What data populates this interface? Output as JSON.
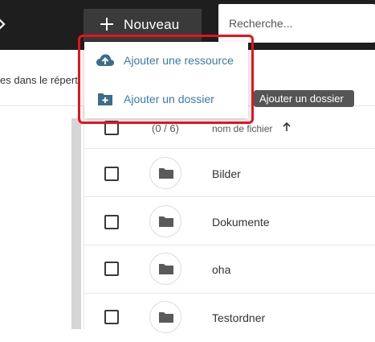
{
  "header": {
    "new_button_label": "Nouveau",
    "search_placeholder": "Recherche..."
  },
  "breadcrumb_text": "es dans le répert",
  "dropdown": {
    "items": [
      {
        "label": "Ajouter une ressource",
        "icon": "cloud-upload-icon"
      },
      {
        "label": "Ajouter un dossier",
        "icon": "folder-plus-icon"
      }
    ]
  },
  "tooltip": "Ajouter un dossier",
  "table": {
    "selection_count": "(0 / 6)",
    "column_name": "nom de fichier",
    "sort_icon": "arrow-up-icon",
    "rows": [
      {
        "name": "Bilder",
        "icon": "folder-icon"
      },
      {
        "name": "Dokumente",
        "icon": "folder-icon"
      },
      {
        "name": "oha",
        "icon": "folder-icon"
      },
      {
        "name": "Testordner",
        "icon": "folder-icon"
      }
    ]
  },
  "colors": {
    "topbar": "#1e1e1e",
    "new_button": "#3a3a3a",
    "link_blue": "#3b7aa5",
    "annotation_red": "#e8121d",
    "tooltip": "#555555"
  }
}
